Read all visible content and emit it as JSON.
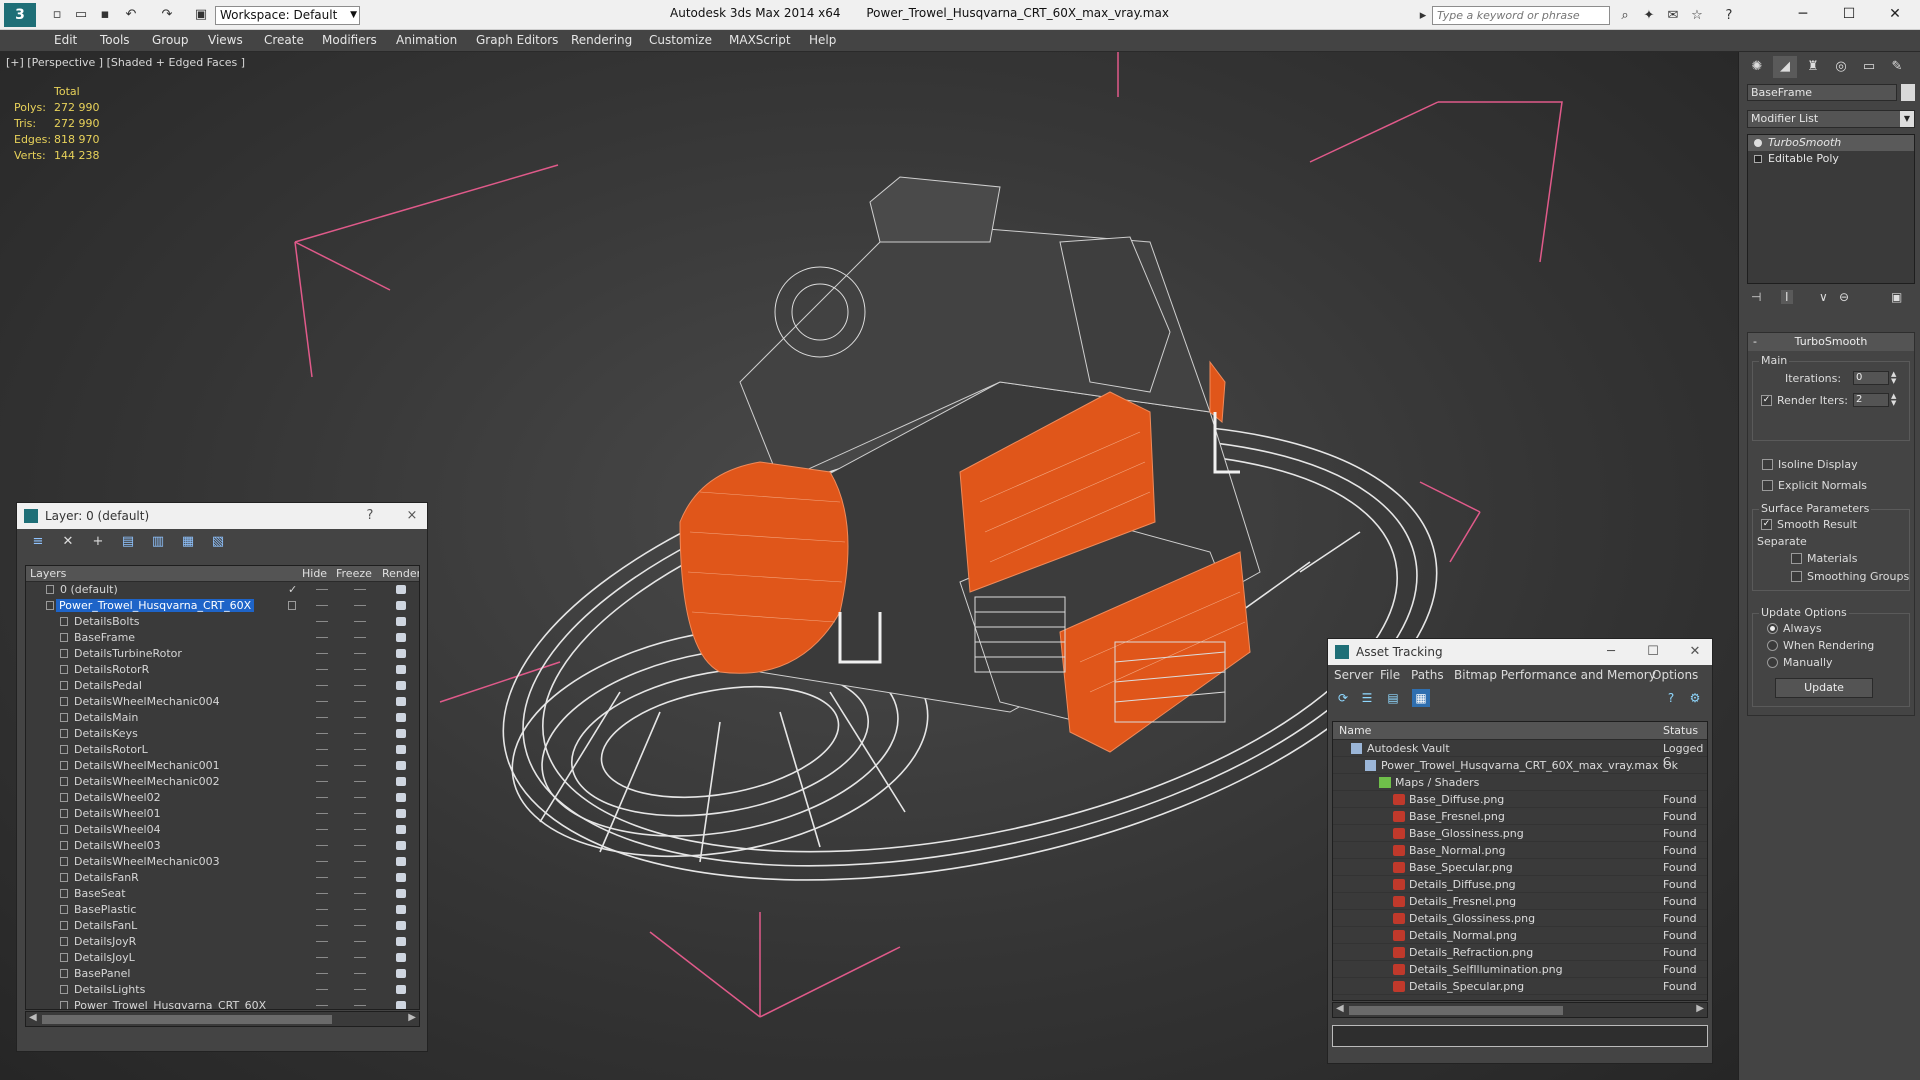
{
  "titlebar": {
    "workspace": "Workspace: Default",
    "app_name": "Autodesk 3ds Max  2014 x64",
    "file_name": "Power_Trowel_Husqvarna_CRT_60X_max_vray.max",
    "search_placeholder": "Type a keyword or phrase"
  },
  "menu": [
    "Edit",
    "Tools",
    "Group",
    "Views",
    "Create",
    "Modifiers",
    "Animation",
    "Graph Editors",
    "Rendering",
    "Customize",
    "MAXScript",
    "Help"
  ],
  "viewport": {
    "label": "[+] [Perspective ] [Shaded + Edged Faces ]",
    "stats_header": "Total",
    "stats": [
      {
        "k": "Polys:",
        "v": "272 990"
      },
      {
        "k": "Tris:",
        "v": "272 990"
      },
      {
        "k": "Edges:",
        "v": "818 970"
      },
      {
        "k": "Verts:",
        "v": "144 238"
      }
    ],
    "colors": {
      "wire": "#e8e8e8",
      "orange": "#e0561a",
      "box": "#e05a8a"
    }
  },
  "layer_explorer": {
    "title": "Layer: 0 (default)",
    "help": "?",
    "close": "×",
    "columns": [
      "Layers",
      "Hide",
      "Freeze",
      "Render"
    ],
    "default_layer": "0 (default)",
    "selected_layer": "Power_Trowel_Husqvarna_CRT_60X",
    "items": [
      "DetailsBolts",
      "BaseFrame",
      "DetailsTurbineRotor",
      "DetailsRotorR",
      "DetailsPedal",
      "DetailsWheelMechanic004",
      "DetailsMain",
      "DetailsKeys",
      "DetailsRotorL",
      "DetailsWheelMechanic001",
      "DetailsWheelMechanic002",
      "DetailsWheel02",
      "DetailsWheel01",
      "DetailsWheel04",
      "DetailsWheel03",
      "DetailsWheelMechanic003",
      "DetailsFanR",
      "BaseSeat",
      "BasePlastic",
      "DetailsFanL",
      "DetailsJoyR",
      "DetailsJoyL",
      "BasePanel",
      "DetailsLights",
      "Power_Trowel_Husqvarna_CRT_60X"
    ]
  },
  "asset_tracking": {
    "title": "Asset Tracking",
    "menu": [
      "Server",
      "File",
      "Paths",
      "Bitmap Performance and Memory",
      "Options"
    ],
    "columns": [
      "Name",
      "Status"
    ],
    "vault": {
      "name": "Autodesk Vault",
      "status": "Logged C"
    },
    "file": {
      "name": "Power_Trowel_Husqvarna_CRT_60X_max_vray.max",
      "status": "Ok"
    },
    "maps_folder": "Maps / Shaders",
    "maps": [
      {
        "name": "Base_Diffuse.png",
        "status": "Found"
      },
      {
        "name": "Base_Fresnel.png",
        "status": "Found"
      },
      {
        "name": "Base_Glossiness.png",
        "status": "Found"
      },
      {
        "name": "Base_Normal.png",
        "status": "Found"
      },
      {
        "name": "Base_Specular.png",
        "status": "Found"
      },
      {
        "name": "Details_Diffuse.png",
        "status": "Found"
      },
      {
        "name": "Details_Fresnel.png",
        "status": "Found"
      },
      {
        "name": "Details_Glossiness.png",
        "status": "Found"
      },
      {
        "name": "Details_Normal.png",
        "status": "Found"
      },
      {
        "name": "Details_Refraction.png",
        "status": "Found"
      },
      {
        "name": "Details_SelfIllumination.png",
        "status": "Found"
      },
      {
        "name": "Details_Specular.png",
        "status": "Found"
      }
    ]
  },
  "command_panel": {
    "object_name": "BaseFrame",
    "modifier_list": "Modifier List",
    "stack": [
      "TurboSmooth",
      "Editable Poly"
    ],
    "rollout_title": "TurboSmooth",
    "main_label": "Main",
    "iterations_label": "Iterations:",
    "iterations_value": "0",
    "render_iters_label": "Render Iters:",
    "render_iters_value": "2",
    "isoline_label": "Isoline Display",
    "explicit_normals_label": "Explicit Normals",
    "surface_params_label": "Surface Parameters",
    "smooth_result_label": "Smooth Result",
    "separate_label": "Separate",
    "materials_label": "Materials",
    "smoothing_groups_label": "Smoothing Groups",
    "update_options_label": "Update Options",
    "always_label": "Always",
    "when_rendering_label": "When Rendering",
    "manually_label": "Manually",
    "update_button": "Update"
  }
}
